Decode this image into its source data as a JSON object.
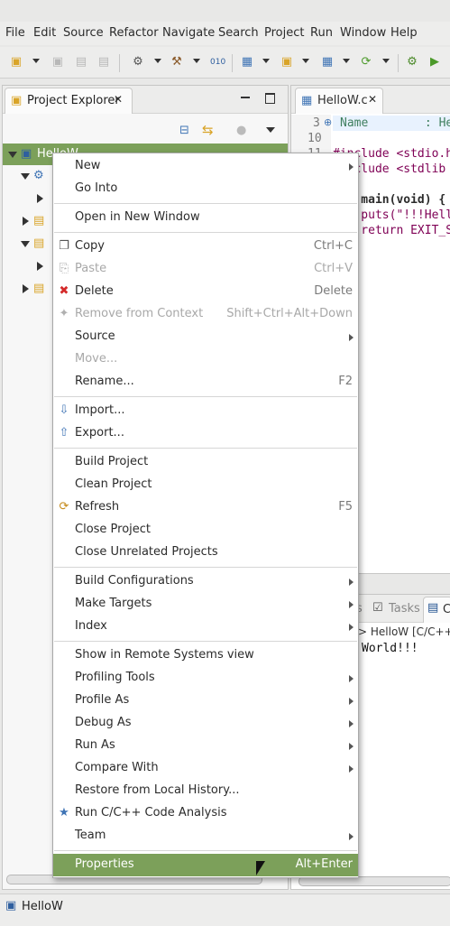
{
  "menubar": {
    "items": [
      "File",
      "Edit",
      "Source",
      "Refactor",
      "Navigate",
      "Search",
      "Project",
      "Run",
      "Window",
      "Help"
    ]
  },
  "project_explorer": {
    "tab_title": "Project Explorer",
    "tree_root": "HelloW"
  },
  "editor": {
    "tab_title": "HelloW.c",
    "line_numbers": [
      "3",
      "10",
      "11"
    ],
    "lines": [
      "Name        : He",
      "",
      "#include <stdio.h",
      "#include <stdlib",
      "",
      "int main(void) {",
      "    puts(\"!!!Hell",
      "    return EXIT_S"
    ]
  },
  "console": {
    "tabs": [
      "s",
      "Tasks",
      "C"
    ],
    "header": "> HelloW [C/C++ A",
    "output": "World!!!"
  },
  "status_bar": {
    "selected": "HelloW"
  },
  "context_menu": {
    "items": [
      {
        "label": "New",
        "accel": "",
        "submenu": true
      },
      {
        "label": "Go Into",
        "accel": ""
      },
      {
        "sep": true
      },
      {
        "label": "Open in New Window",
        "accel": ""
      },
      {
        "sep": true
      },
      {
        "label": "Copy",
        "accel": "Ctrl+C",
        "icon": "copy-icon"
      },
      {
        "label": "Paste",
        "accel": "Ctrl+V",
        "icon": "paste-icon",
        "disabled": true
      },
      {
        "label": "Delete",
        "accel": "Delete",
        "icon": "delete-icon"
      },
      {
        "label": "Remove from Context",
        "accel": "Shift+Ctrl+Alt+Down",
        "icon": "remove-context-icon",
        "disabled": true
      },
      {
        "label": "Source",
        "accel": "",
        "submenu": true
      },
      {
        "label": "Move...",
        "accel": "",
        "disabled": true
      },
      {
        "label": "Rename...",
        "accel": "F2"
      },
      {
        "sep": true
      },
      {
        "label": "Import...",
        "accel": "",
        "icon": "import-icon"
      },
      {
        "label": "Export...",
        "accel": "",
        "icon": "export-icon"
      },
      {
        "sep": true
      },
      {
        "label": "Build Project",
        "accel": ""
      },
      {
        "label": "Clean Project",
        "accel": ""
      },
      {
        "label": "Refresh",
        "accel": "F5",
        "icon": "refresh-icon"
      },
      {
        "label": "Close Project",
        "accel": ""
      },
      {
        "label": "Close Unrelated Projects",
        "accel": ""
      },
      {
        "sep": true
      },
      {
        "label": "Build Configurations",
        "accel": "",
        "submenu": true
      },
      {
        "label": "Make Targets",
        "accel": "",
        "submenu": true
      },
      {
        "label": "Index",
        "accel": "",
        "submenu": true
      },
      {
        "sep": true
      },
      {
        "label": "Show in Remote Systems view",
        "accel": ""
      },
      {
        "label": "Profiling Tools",
        "accel": "",
        "submenu": true
      },
      {
        "label": "Profile As",
        "accel": "",
        "submenu": true
      },
      {
        "label": "Debug As",
        "accel": "",
        "submenu": true
      },
      {
        "label": "Run As",
        "accel": "",
        "submenu": true
      },
      {
        "label": "Compare With",
        "accel": "",
        "submenu": true
      },
      {
        "label": "Restore from Local History...",
        "accel": ""
      },
      {
        "label": "Run C/C++ Code Analysis",
        "accel": "",
        "icon": "code-analysis-icon"
      },
      {
        "label": "Team",
        "accel": "",
        "submenu": true
      },
      {
        "sep": true
      },
      {
        "label": "Properties",
        "accel": "Alt+Enter",
        "highlighted": true
      }
    ]
  },
  "colors": {
    "highlight": "#7ca05a",
    "keyword": "#7f0055",
    "string": "#2a00ff",
    "comment": "#3f7f5f"
  }
}
